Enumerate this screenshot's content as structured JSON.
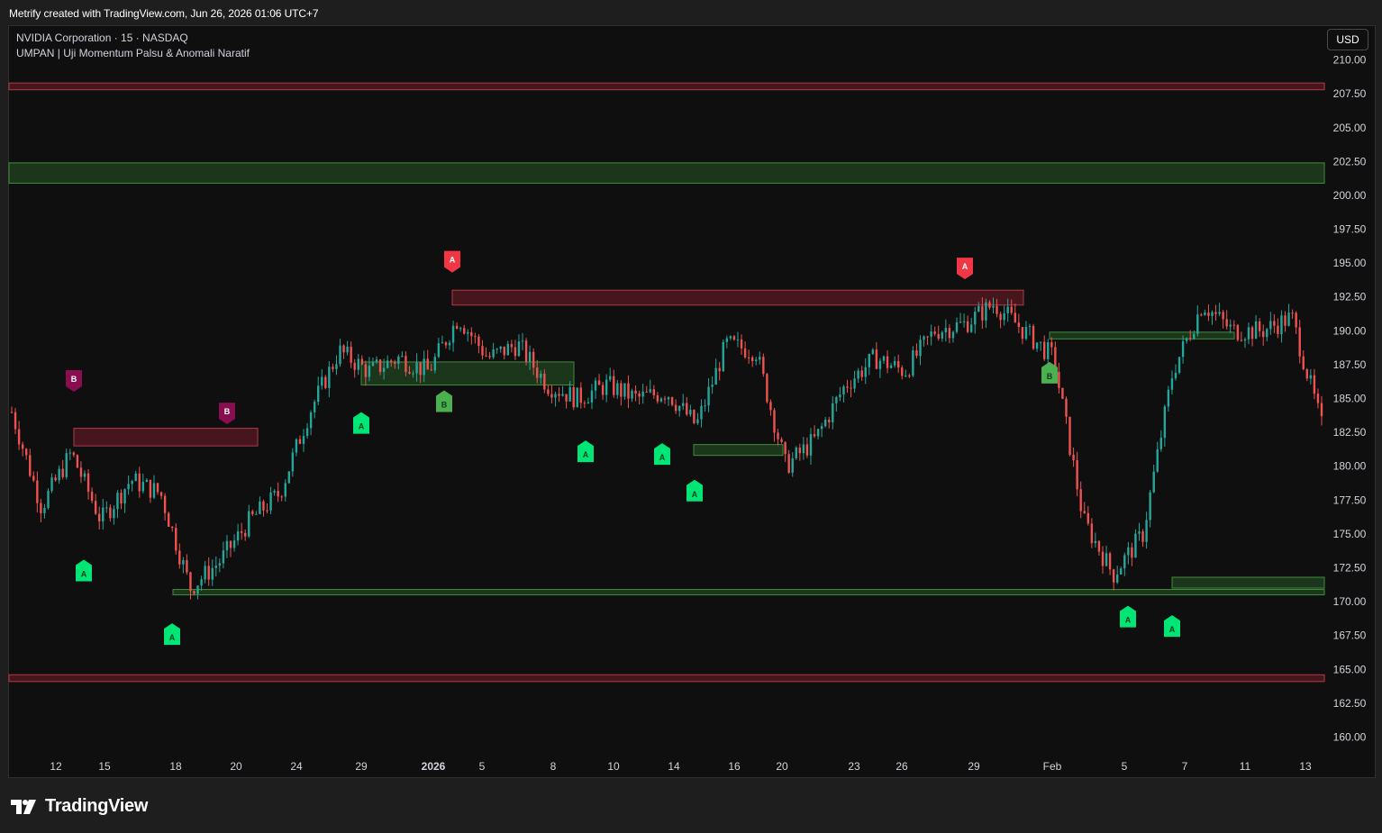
{
  "credit": "Metrify created with TradingView.com, Jun 26, 2026 01:06 UTC+7",
  "legend": {
    "symbol": "NVIDIA Corporation · 15 · NASDAQ",
    "indicator": "UMPAN | Uji Momentum Palsu & Anomali Naratif"
  },
  "currency_button": "USD",
  "brand": "TradingView",
  "colors": {
    "background": "#0f0f0f",
    "up_candle": "#26a69a",
    "down_candle": "#ef5350",
    "bull_zone": "#1f3d1f",
    "bear_zone": "#5a1a22",
    "signal_a_bull": "#00e676",
    "signal_b_bull": "#4caf50",
    "signal_a_bear": "#f23645",
    "signal_b_bear": "#880e4f"
  },
  "chart_data": {
    "type": "line",
    "title": "",
    "xlabel": "",
    "ylabel": "",
    "x_tick_labels": [
      "12",
      "15",
      "18",
      "20",
      "24",
      "29",
      "2026",
      "5",
      "8",
      "10",
      "14",
      "16",
      "20",
      "23",
      "26",
      "29",
      "Feb",
      "5",
      "7",
      "11",
      "13"
    ],
    "y_ticks": [
      "160.00",
      "162.50",
      "165.00",
      "167.50",
      "170.00",
      "172.50",
      "175.00",
      "177.50",
      "180.00",
      "182.50",
      "185.00",
      "187.50",
      "190.00",
      "192.50",
      "195.00",
      "197.50",
      "200.00",
      "202.50",
      "205.00",
      "207.50",
      "210.00"
    ],
    "ylim": [
      158.7,
      212.5
    ],
    "x": [
      "12",
      "",
      "15",
      "",
      "",
      "18",
      "",
      "20",
      "",
      "24",
      "",
      "29",
      "",
      "2026",
      "",
      "5",
      "",
      "",
      "8",
      "",
      "10",
      "",
      "14",
      "",
      "16",
      "",
      "20",
      "",
      "23",
      "",
      "26",
      "",
      "29",
      "",
      "Feb",
      "",
      "",
      "5",
      "",
      "7",
      "",
      "11",
      "",
      "13",
      ""
    ],
    "series": [
      {
        "values": [
          184,
          177,
          181,
          176,
          179,
          178,
          171,
          173,
          176,
          178,
          184,
          188.5,
          187,
          188,
          187,
          191,
          188,
          189,
          186,
          185,
          186,
          185,
          185.5,
          183,
          189,
          188.5,
          180,
          182,
          186,
          188,
          187,
          190,
          190.5,
          192,
          190,
          188,
          176,
          172,
          175,
          187,
          192,
          190,
          190,
          191,
          183
        ]
      }
    ],
    "zones": [
      {
        "kind": "bear",
        "low": 207.8,
        "high": 208.3,
        "label": ""
      },
      {
        "kind": "bull",
        "low": 200.9,
        "high": 202.4,
        "label": ""
      },
      {
        "kind": "bear",
        "low": 164.1,
        "high": 164.6,
        "label": ""
      },
      {
        "kind": "bull",
        "low": 170.5,
        "high": 170.9,
        "label": ""
      },
      {
        "kind": "bear",
        "low": 181.5,
        "high": 182.8,
        "label": ""
      },
      {
        "kind": "bear",
        "low": 191.9,
        "high": 193.0,
        "label": ""
      },
      {
        "kind": "bull",
        "low": 186.0,
        "high": 187.7,
        "label": ""
      },
      {
        "kind": "bull",
        "low": 180.8,
        "high": 181.6,
        "label": ""
      },
      {
        "kind": "bull",
        "low": 189.4,
        "high": 189.9,
        "label": ""
      },
      {
        "kind": "bull",
        "low": 171.0,
        "high": 171.8,
        "label": ""
      }
    ],
    "signals": [
      {
        "label": "B",
        "kind": "bear",
        "price": 185.9
      },
      {
        "label": "B",
        "kind": "bear",
        "price": 183.5
      },
      {
        "label": "A",
        "kind": "bear",
        "price": 194.7
      },
      {
        "label": "A",
        "kind": "bear",
        "price": 194.2
      },
      {
        "label": "A",
        "kind": "bull",
        "price": 172.7
      },
      {
        "label": "A",
        "kind": "bull",
        "price": 168.0
      },
      {
        "label": "A",
        "kind": "bull",
        "price": 183.6
      },
      {
        "label": "B",
        "kind": "bull",
        "price": 185.2
      },
      {
        "label": "A",
        "kind": "bull",
        "price": 181.5
      },
      {
        "label": "A",
        "kind": "bull",
        "price": 181.3
      },
      {
        "label": "A",
        "kind": "bull",
        "price": 178.6
      },
      {
        "label": "B",
        "kind": "bull",
        "price": 187.3
      },
      {
        "label": "A",
        "kind": "bull",
        "price": 169.3
      },
      {
        "label": "A",
        "kind": "bull",
        "price": 168.6
      }
    ]
  }
}
